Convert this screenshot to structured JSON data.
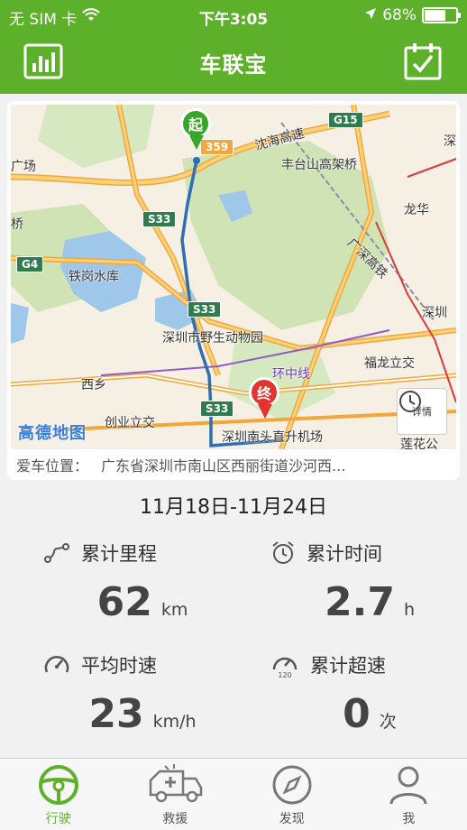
{
  "status_bar": {
    "carrier": "无 SIM 卡",
    "time": "下午3:05",
    "battery": "68%",
    "battery_level": 0.68
  },
  "header": {
    "title": "车联宝"
  },
  "map": {
    "labels": {
      "guangchang": "广场",
      "qiao": "桥",
      "tiegang": "铁岗水库",
      "wildlife": "深圳市野生动物园",
      "xixiang": "西乡",
      "chuangye": "创业立交",
      "airport": "深圳南头直升机场",
      "fenglin": "丰台山高架桥",
      "longhua": "龙华",
      "fulong": "福龙立交",
      "huanzhong": "环中线",
      "yanhai": "沈海高速",
      "guangshen": "广深高铁",
      "shen": "深圳",
      "lianhua": "莲花公",
      "shen2": "深"
    },
    "shields": {
      "g15": "G15",
      "s33a": "S33",
      "s33b": "S33",
      "s33c": "S33",
      "g4": "G4",
      "s359": "359"
    },
    "start_label": "起",
    "end_label": "终",
    "detail_label": "详情",
    "brand": "高德地图"
  },
  "location": {
    "label": "爱车位置：",
    "value": "广东省深圳市南山区西丽街道沙河西..."
  },
  "date_range": "11月18日-11月24日",
  "stats": {
    "mileage": {
      "label": "累计里程",
      "value": "62",
      "unit": "km"
    },
    "time": {
      "label": "累计时间",
      "value": "2.7",
      "unit": "h"
    },
    "speed": {
      "label": "平均时速",
      "value": "23",
      "unit": "km/h"
    },
    "overspeed": {
      "label": "累计超速",
      "value": "0",
      "unit": "次",
      "icon_text": "120"
    }
  },
  "tabs": [
    {
      "label": "行驶",
      "icon": "steering-wheel-icon"
    },
    {
      "label": "救援",
      "icon": "ambulance-icon"
    },
    {
      "label": "发现",
      "icon": "compass-icon"
    },
    {
      "label": "我",
      "icon": "person-icon"
    }
  ],
  "colors": {
    "brand_green": "#5db02a",
    "start_pin": "#3aa629",
    "end_pin": "#e3342f",
    "route": "#2c6fb3"
  }
}
